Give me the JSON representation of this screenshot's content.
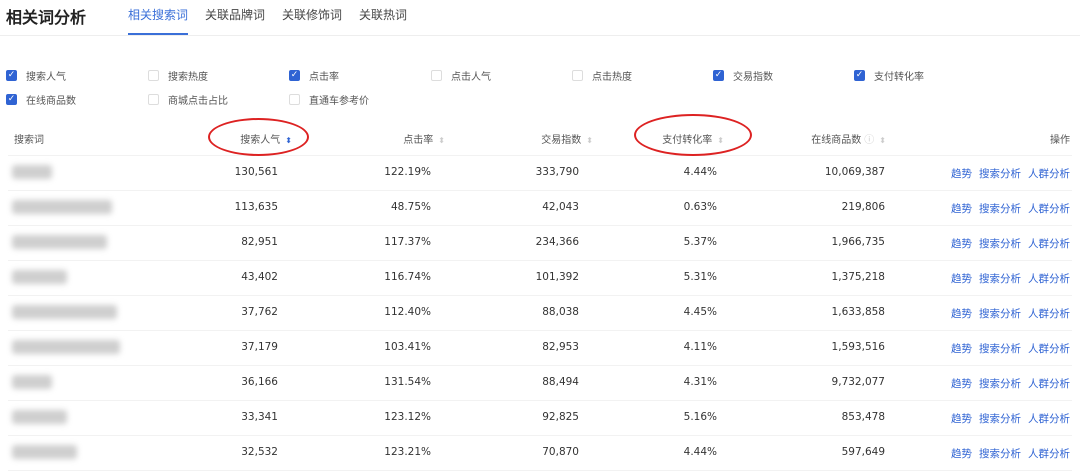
{
  "title": "相关词分析",
  "tabs": [
    "相关搜索词",
    "关联品牌词",
    "关联修饰词",
    "关联热词"
  ],
  "checkboxes": [
    {
      "label": "搜索人气",
      "checked": true
    },
    {
      "label": "搜索热度",
      "checked": false
    },
    {
      "label": "点击率",
      "checked": true
    },
    {
      "label": "点击人气",
      "checked": false
    },
    {
      "label": "点击热度",
      "checked": false
    },
    {
      "label": "交易指数",
      "checked": true
    },
    {
      "label": "支付转化率",
      "checked": true
    },
    {
      "label": "在线商品数",
      "checked": true
    },
    {
      "label": "商城点击占比",
      "checked": false
    },
    {
      "label": "直通车参考价",
      "checked": false
    }
  ],
  "columns": [
    "搜索词",
    "搜索人气",
    "点击率",
    "交易指数",
    "支付转化率",
    "在线商品数",
    "操作"
  ],
  "actions": [
    "趋势",
    "搜索分析",
    "人群分析"
  ],
  "rows": [
    [
      "130,561",
      "122.19%",
      "333,790",
      "4.44%",
      "10,069,387"
    ],
    [
      "113,635",
      "48.75%",
      "42,043",
      "0.63%",
      "219,806"
    ],
    [
      "82,951",
      "117.37%",
      "234,366",
      "5.37%",
      "1,966,735"
    ],
    [
      "43,402",
      "116.74%",
      "101,392",
      "5.31%",
      "1,375,218"
    ],
    [
      "37,762",
      "112.40%",
      "88,038",
      "4.45%",
      "1,633,858"
    ],
    [
      "37,179",
      "103.41%",
      "82,953",
      "4.11%",
      "1,593,516"
    ],
    [
      "36,166",
      "131.54%",
      "88,494",
      "4.31%",
      "9,732,077"
    ],
    [
      "33,341",
      "123.12%",
      "92,825",
      "5.16%",
      "853,478"
    ],
    [
      "32,532",
      "123.21%",
      "70,870",
      "4.44%",
      "597,649"
    ]
  ],
  "accent": "#2f63d3"
}
